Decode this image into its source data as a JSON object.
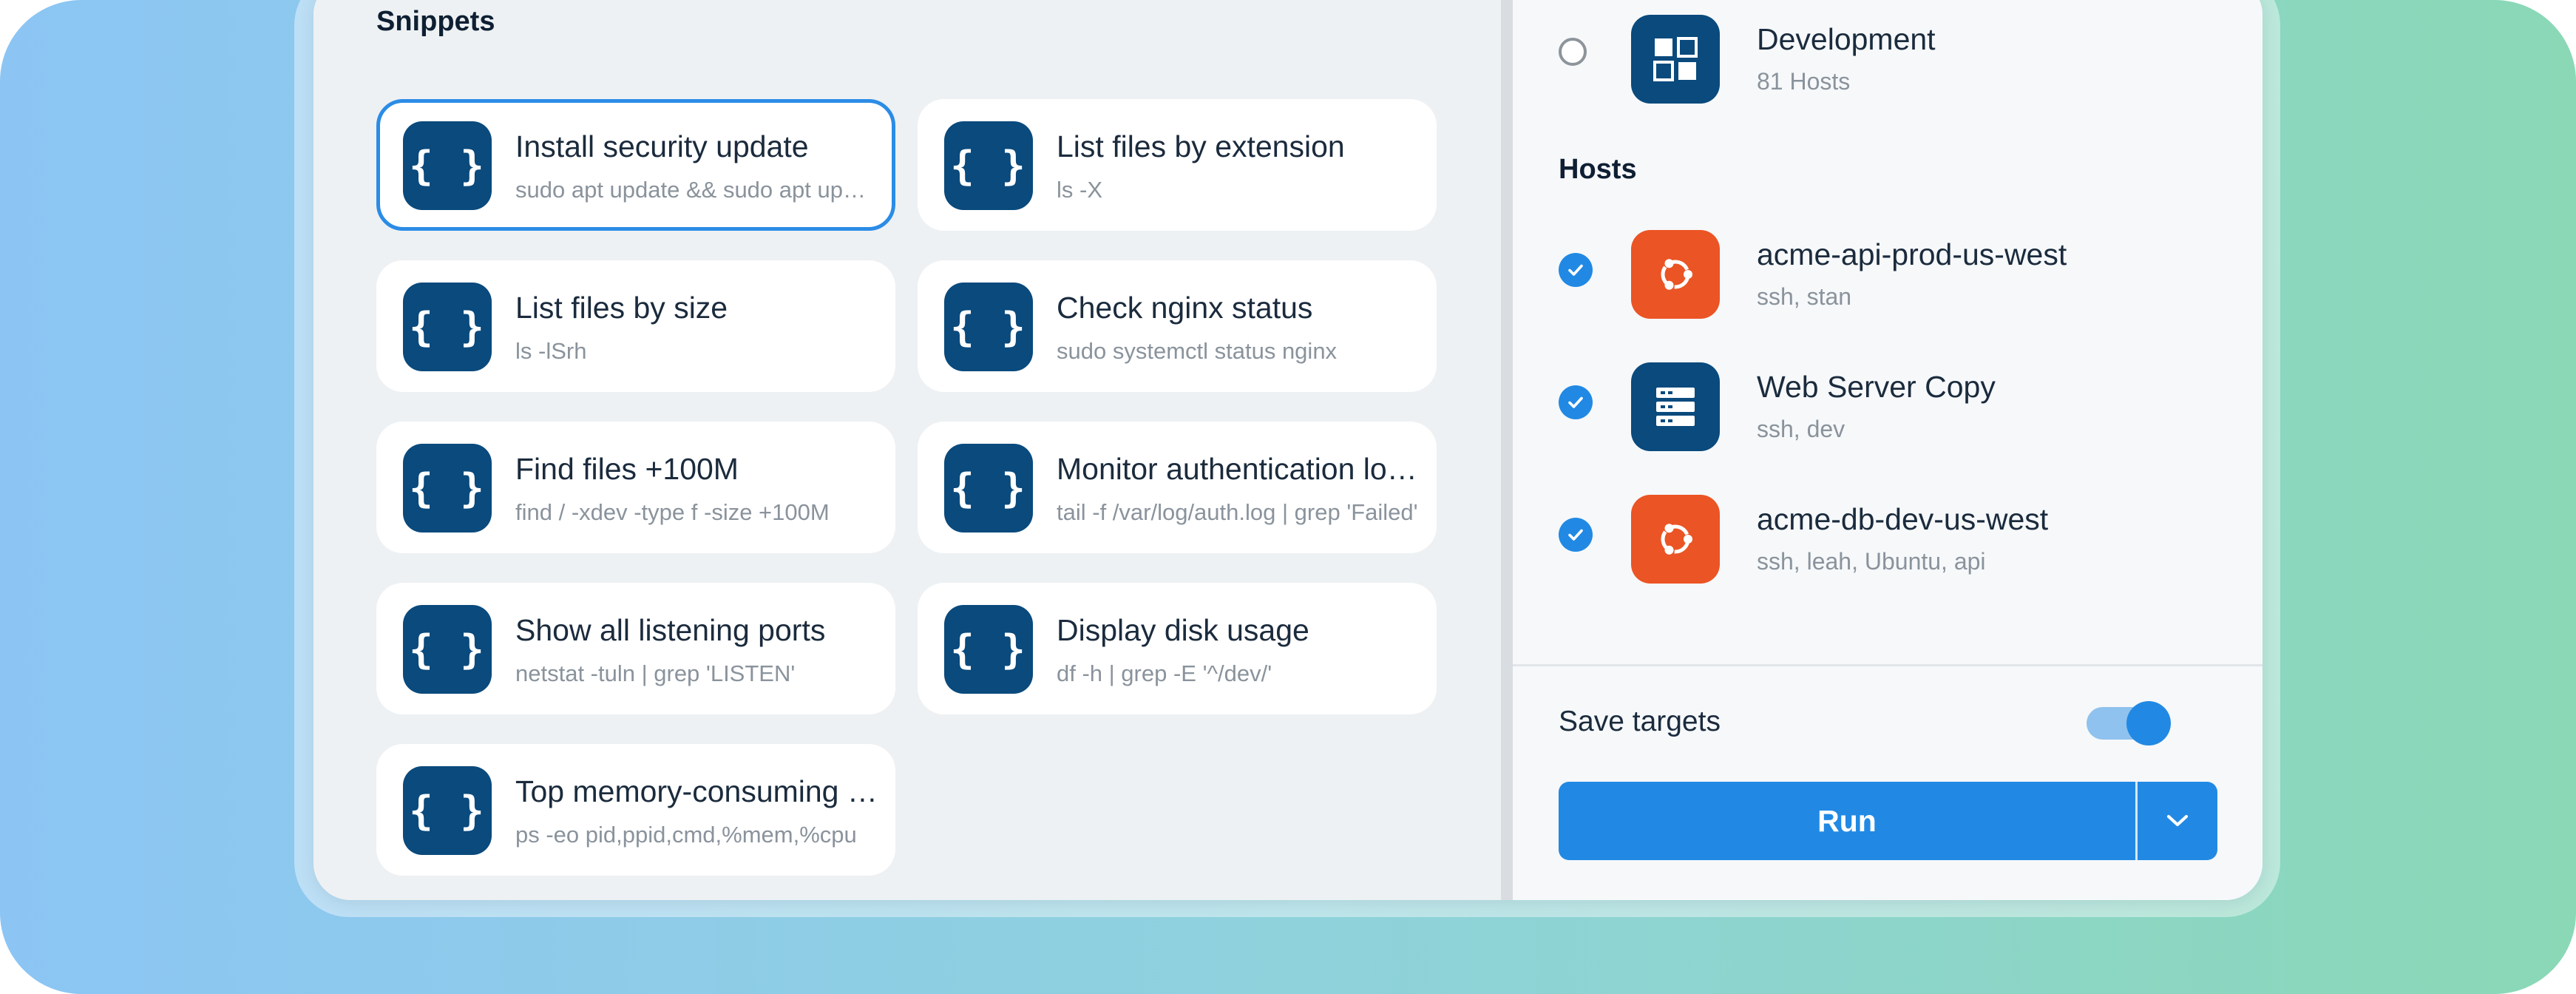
{
  "snippets": {
    "title": "Snippets",
    "badge_glyph": "{ }",
    "items": [
      {
        "title": "Install security update",
        "command": "sudo apt update && sudo apt upgrade",
        "selected": true
      },
      {
        "title": "List files by extension",
        "command": "ls -X",
        "selected": false
      },
      {
        "title": "List files by size",
        "command": "ls -lSrh",
        "selected": false
      },
      {
        "title": "Check nginx status",
        "command": "sudo systemctl status nginx",
        "selected": false
      },
      {
        "title": "Find files +100M",
        "command": "find / -xdev -type f -size +100M",
        "selected": false
      },
      {
        "title": "Monitor authentication logs",
        "command": "tail -f /var/log/auth.log | grep 'Failed'",
        "selected": false
      },
      {
        "title": "Show all listening ports",
        "command": "netstat -tuln | grep 'LISTEN'",
        "selected": false
      },
      {
        "title": "Display disk usage",
        "command": "df -h | grep -E '^/dev/'",
        "selected": false
      },
      {
        "title": "Top memory-consuming processes",
        "command": "ps -eo pid,ppid,cmd,%mem,%cpu",
        "selected": false
      }
    ]
  },
  "groups": [
    {
      "name": "Development",
      "subtitle": "81 Hosts",
      "icon": "group-icon",
      "selected": false
    }
  ],
  "hosts": {
    "title": "Hosts",
    "items": [
      {
        "name": "acme-api-prod-us-west",
        "tags": "ssh, stan",
        "icon": "ubuntu-icon",
        "checked": true
      },
      {
        "name": "Web Server Copy",
        "tags": "ssh, dev",
        "icon": "server-icon",
        "checked": true
      },
      {
        "name": "acme-db-dev-us-west",
        "tags": "ssh, leah, Ubuntu, api",
        "icon": "ubuntu-icon",
        "checked": true
      }
    ]
  },
  "footer": {
    "save_targets_label": "Save targets",
    "save_targets_on": true,
    "run_label": "Run"
  },
  "colors": {
    "accent": "#2189e4",
    "snippet_badge": "#0a4a7d",
    "ubuntu": "#eb5424"
  }
}
